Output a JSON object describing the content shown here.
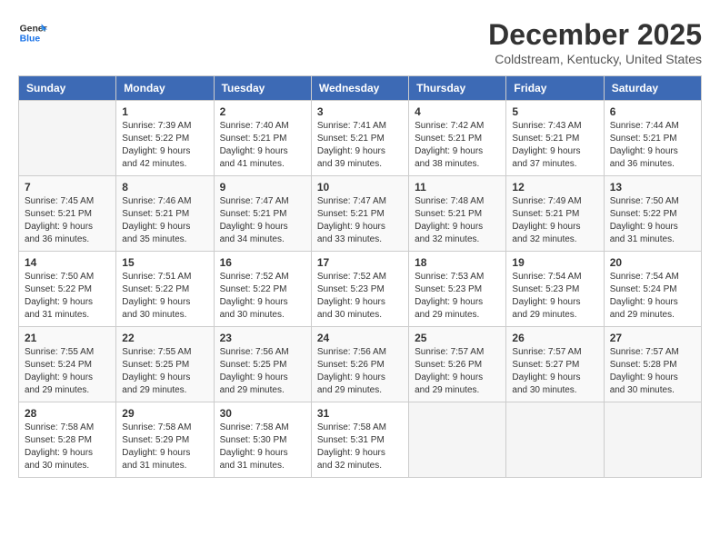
{
  "header": {
    "logo_line1": "General",
    "logo_line2": "Blue",
    "title": "December 2025",
    "subtitle": "Coldstream, Kentucky, United States"
  },
  "weekdays": [
    "Sunday",
    "Monday",
    "Tuesday",
    "Wednesday",
    "Thursday",
    "Friday",
    "Saturday"
  ],
  "weeks": [
    [
      {
        "day": "",
        "empty": true
      },
      {
        "day": "1",
        "sunrise": "7:39 AM",
        "sunset": "5:22 PM",
        "daylight": "9 hours and 42 minutes."
      },
      {
        "day": "2",
        "sunrise": "7:40 AM",
        "sunset": "5:21 PM",
        "daylight": "9 hours and 41 minutes."
      },
      {
        "day": "3",
        "sunrise": "7:41 AM",
        "sunset": "5:21 PM",
        "daylight": "9 hours and 39 minutes."
      },
      {
        "day": "4",
        "sunrise": "7:42 AM",
        "sunset": "5:21 PM",
        "daylight": "9 hours and 38 minutes."
      },
      {
        "day": "5",
        "sunrise": "7:43 AM",
        "sunset": "5:21 PM",
        "daylight": "9 hours and 37 minutes."
      },
      {
        "day": "6",
        "sunrise": "7:44 AM",
        "sunset": "5:21 PM",
        "daylight": "9 hours and 36 minutes."
      }
    ],
    [
      {
        "day": "7",
        "sunrise": "7:45 AM",
        "sunset": "5:21 PM",
        "daylight": "9 hours and 36 minutes."
      },
      {
        "day": "8",
        "sunrise": "7:46 AM",
        "sunset": "5:21 PM",
        "daylight": "9 hours and 35 minutes."
      },
      {
        "day": "9",
        "sunrise": "7:47 AM",
        "sunset": "5:21 PM",
        "daylight": "9 hours and 34 minutes."
      },
      {
        "day": "10",
        "sunrise": "7:47 AM",
        "sunset": "5:21 PM",
        "daylight": "9 hours and 33 minutes."
      },
      {
        "day": "11",
        "sunrise": "7:48 AM",
        "sunset": "5:21 PM",
        "daylight": "9 hours and 32 minutes."
      },
      {
        "day": "12",
        "sunrise": "7:49 AM",
        "sunset": "5:21 PM",
        "daylight": "9 hours and 32 minutes."
      },
      {
        "day": "13",
        "sunrise": "7:50 AM",
        "sunset": "5:22 PM",
        "daylight": "9 hours and 31 minutes."
      }
    ],
    [
      {
        "day": "14",
        "sunrise": "7:50 AM",
        "sunset": "5:22 PM",
        "daylight": "9 hours and 31 minutes."
      },
      {
        "day": "15",
        "sunrise": "7:51 AM",
        "sunset": "5:22 PM",
        "daylight": "9 hours and 30 minutes."
      },
      {
        "day": "16",
        "sunrise": "7:52 AM",
        "sunset": "5:22 PM",
        "daylight": "9 hours and 30 minutes."
      },
      {
        "day": "17",
        "sunrise": "7:52 AM",
        "sunset": "5:23 PM",
        "daylight": "9 hours and 30 minutes."
      },
      {
        "day": "18",
        "sunrise": "7:53 AM",
        "sunset": "5:23 PM",
        "daylight": "9 hours and 29 minutes."
      },
      {
        "day": "19",
        "sunrise": "7:54 AM",
        "sunset": "5:23 PM",
        "daylight": "9 hours and 29 minutes."
      },
      {
        "day": "20",
        "sunrise": "7:54 AM",
        "sunset": "5:24 PM",
        "daylight": "9 hours and 29 minutes."
      }
    ],
    [
      {
        "day": "21",
        "sunrise": "7:55 AM",
        "sunset": "5:24 PM",
        "daylight": "9 hours and 29 minutes."
      },
      {
        "day": "22",
        "sunrise": "7:55 AM",
        "sunset": "5:25 PM",
        "daylight": "9 hours and 29 minutes."
      },
      {
        "day": "23",
        "sunrise": "7:56 AM",
        "sunset": "5:25 PM",
        "daylight": "9 hours and 29 minutes."
      },
      {
        "day": "24",
        "sunrise": "7:56 AM",
        "sunset": "5:26 PM",
        "daylight": "9 hours and 29 minutes."
      },
      {
        "day": "25",
        "sunrise": "7:57 AM",
        "sunset": "5:26 PM",
        "daylight": "9 hours and 29 minutes."
      },
      {
        "day": "26",
        "sunrise": "7:57 AM",
        "sunset": "5:27 PM",
        "daylight": "9 hours and 30 minutes."
      },
      {
        "day": "27",
        "sunrise": "7:57 AM",
        "sunset": "5:28 PM",
        "daylight": "9 hours and 30 minutes."
      }
    ],
    [
      {
        "day": "28",
        "sunrise": "7:58 AM",
        "sunset": "5:28 PM",
        "daylight": "9 hours and 30 minutes."
      },
      {
        "day": "29",
        "sunrise": "7:58 AM",
        "sunset": "5:29 PM",
        "daylight": "9 hours and 31 minutes."
      },
      {
        "day": "30",
        "sunrise": "7:58 AM",
        "sunset": "5:30 PM",
        "daylight": "9 hours and 31 minutes."
      },
      {
        "day": "31",
        "sunrise": "7:58 AM",
        "sunset": "5:31 PM",
        "daylight": "9 hours and 32 minutes."
      },
      {
        "day": "",
        "empty": true
      },
      {
        "day": "",
        "empty": true
      },
      {
        "day": "",
        "empty": true
      }
    ]
  ],
  "labels": {
    "sunrise": "Sunrise:",
    "sunset": "Sunset:",
    "daylight": "Daylight:"
  }
}
